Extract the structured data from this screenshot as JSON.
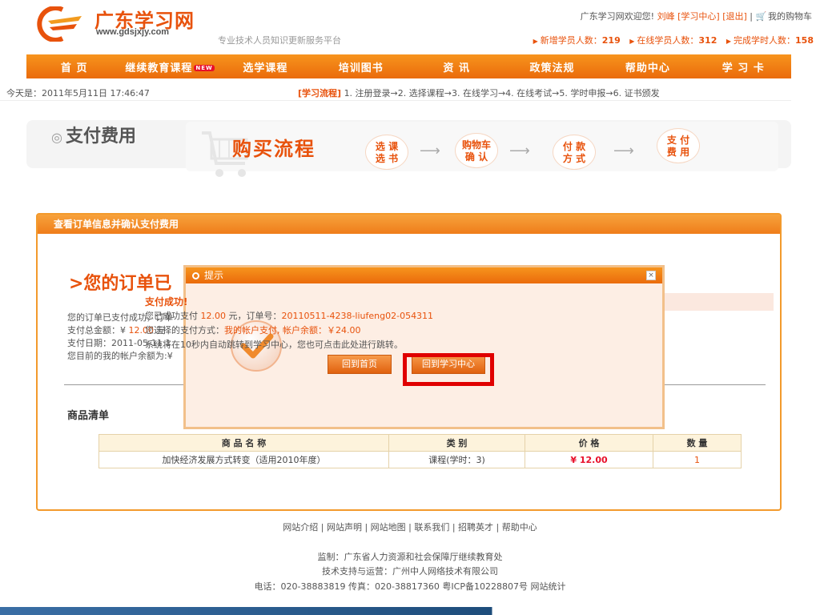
{
  "header": {
    "logo_text": "广东学习网",
    "logo_url": "www.gdsjxjy.com",
    "slogan": "专业技术人员知识更新服务平台",
    "welcome_prefix": "广东学习网欢迎您!",
    "user_name": "刘峰",
    "study_center_link": "[学习中心]",
    "logout_link": "[退出]",
    "separator": "|",
    "cart_link": "我的购物车",
    "stats": [
      {
        "label": "新增学员人数：",
        "value": "219"
      },
      {
        "label": "在线学员人数：",
        "value": "312"
      },
      {
        "label": "完成学时人数：",
        "value": "158"
      }
    ]
  },
  "nav": {
    "items": [
      "首  页",
      "继续教育课程",
      "选学课程",
      "培训图书",
      "资  讯",
      "政策法规",
      "帮助中心",
      "学 习 卡"
    ],
    "new_badge": "NEW"
  },
  "infobar": {
    "date": "今天是：2011年5月11日 17:46:47",
    "flow_label": "[学习流程]",
    "flow_steps": "1. 注册登录→2. 选择课程→3. 在线学习→4. 在线考试→5. 学时申报→6. 证书颁发"
  },
  "banner": {
    "title": "支付费用",
    "flow_title": "购买流程",
    "steps": [
      {
        "line1": "选 课",
        "line2": "选 书"
      },
      {
        "line1": "购物车",
        "line2": "确 认"
      },
      {
        "line1": "付 款",
        "line2": "方 式"
      },
      {
        "line1": "支 付",
        "line2": "费 用"
      }
    ]
  },
  "panel": {
    "head": "查看订单信息并确认支付费用",
    "heading": ">您的订单已",
    "lines": [
      {
        "text": "您的订单已支付成功，订单"
      },
      {
        "label": "支付总金额：¥ ",
        "value": "12.00",
        "suffix": " 元"
      },
      {
        "label": "支付日期：",
        "value": "2011-05-11 1"
      },
      {
        "text": "您目前的我的帐户余额为:¥"
      }
    ],
    "list_title": "商品清单",
    "table": {
      "headers": [
        "商 品 名 称",
        "类 别",
        "价 格",
        "数 量"
      ],
      "rows": [
        {
          "name": "加快经济发展方式转变（适用2010年度）",
          "category": "课程(学时：3)",
          "price": "¥ 12.00",
          "qty": "1"
        }
      ]
    }
  },
  "modal": {
    "title": "提示",
    "close": "×",
    "success": "支付成功!",
    "line1_pre": "您已成功支付 ",
    "amount": "12.00",
    "line1_mid": " 元，订单号：",
    "order_no": "20110511-4238-liufeng02-054311",
    "line2_pre": "您选择的支付方式：",
    "pay_method": "我的帐户支付, 帐户余额：￥24.00",
    "line3": "系统将在10秒内自动跳转到学习中心，您也可点击此处进行跳转。",
    "btn_home": "回到首页",
    "btn_center": "回到学习中心"
  },
  "footer": {
    "links": "网站介绍 | 网站声明 | 网站地图 | 联系我们 | 招聘英才 | 帮助中心",
    "supervisor": "监制：广东省人力资源和社会保障厅继续教育处",
    "support": "技术支持与运营：广州中人网络技术有限公司",
    "contact": "电话：020-38883819  传真：020-38817360  粤ICP备10228807号  网站统计"
  }
}
